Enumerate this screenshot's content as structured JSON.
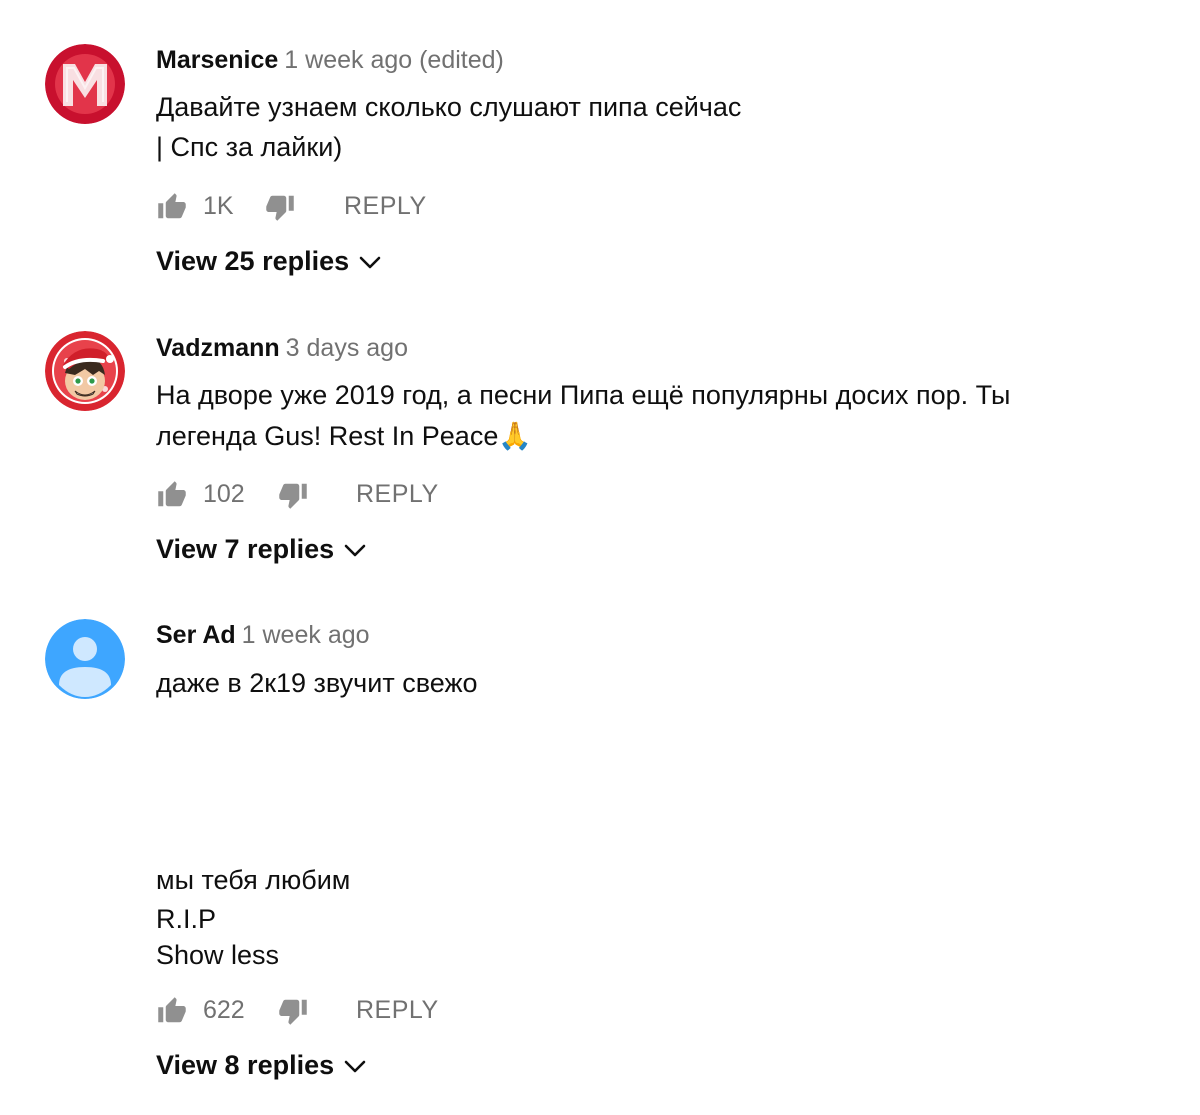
{
  "comments": [
    {
      "author": "Marsenice",
      "time": "1 week ago (edited)",
      "lines": [
        "Давайте узнаем сколько слушают пипа сейчас",
        "| Спс за лайки)"
      ],
      "likes": "1K",
      "reply_label": "REPLY",
      "view_replies": "View 25 replies"
    },
    {
      "author": "Vadzmann",
      "time": "3 days ago",
      "lines": [
        "На дворе уже 2019 год, а песни Пипа ещё популярны досих пор. Ты",
        "легенда Gus! Rest In Peace🙏"
      ],
      "likes": "102",
      "reply_label": "REPLY",
      "view_replies": "View 7 replies"
    },
    {
      "author": "Ser Ad",
      "time": "1 week ago",
      "lines": [
        "даже в 2к19 звучит свежо",
        "мы тебя любим",
        "R.I.P"
      ],
      "show_less": "Show less",
      "likes": "622",
      "reply_label": "REPLY",
      "view_replies": "View 8 replies"
    }
  ],
  "icons": {
    "like": "thumbs-up-icon",
    "dislike": "thumbs-down-icon",
    "expand": "chevron-down-icon"
  },
  "colors": {
    "text": "#0f0f0f",
    "secondary": "#717171",
    "avatar_default": "#3ea6ff"
  }
}
